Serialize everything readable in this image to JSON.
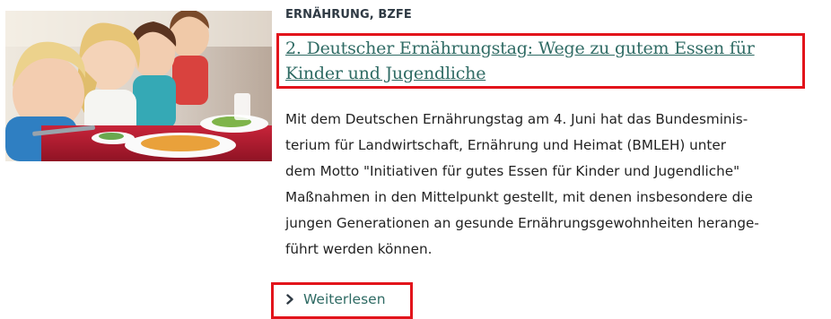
{
  "teaser": {
    "image_alt": "Kinder beim Essen",
    "kicker": "ERNÄHRUNG, BZFE",
    "title_line1": "2. Deutscher Ernährungstag: Wege zu gutem Essen für",
    "title_line2": "Kinder und Jugendliche",
    "body_lines": [
      "Mit dem Deutschen Ernährungstag am 4. Juni hat das Bundesminis-",
      "terium für Landwirtschaft, Ernährung und Heimat (BMLEH) unter",
      "dem Motto \"Initiativen für gutes Essen für Kinder und Jugendliche\"",
      "Maßnahmen in den Mittelpunkt gestellt, mit denen insbesondere die",
      "jungen Generationen an gesunde Ernährungsgewohnheiten herange-",
      "führt werden können."
    ],
    "read_more_label": "Weiterlesen",
    "read_more_icon": "chevron-right-icon"
  },
  "colors": {
    "title": "#2f6b64",
    "link": "#2f6b64",
    "kicker": "#2f3a44",
    "body": "#222222",
    "highlight": "#e2141b"
  }
}
